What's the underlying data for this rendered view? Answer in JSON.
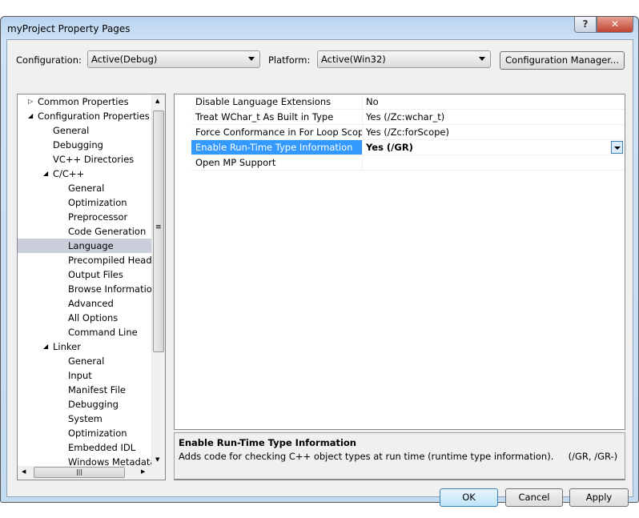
{
  "window": {
    "title": "myProject Property Pages",
    "help": "?",
    "close": "✕"
  },
  "toolbar": {
    "config_label": "Configuration:",
    "config_value": "Active(Debug)",
    "platform_label": "Platform:",
    "platform_value": "Active(Win32)",
    "config_manager": "Configuration Manager..."
  },
  "tree": {
    "items": [
      {
        "label": "Common Properties",
        "level": 0,
        "expander": "collapsed"
      },
      {
        "label": "Configuration Properties",
        "level": 0,
        "expander": "expanded"
      },
      {
        "label": "General",
        "level": 1
      },
      {
        "label": "Debugging",
        "level": 1
      },
      {
        "label": "VC++ Directories",
        "level": 1
      },
      {
        "label": "C/C++",
        "level": 1,
        "expander": "expanded"
      },
      {
        "label": "General",
        "level": 2
      },
      {
        "label": "Optimization",
        "level": 2
      },
      {
        "label": "Preprocessor",
        "level": 2
      },
      {
        "label": "Code Generation",
        "level": 2
      },
      {
        "label": "Language",
        "level": 2,
        "selected": true
      },
      {
        "label": "Precompiled Heade",
        "level": 2
      },
      {
        "label": "Output Files",
        "level": 2
      },
      {
        "label": "Browse Information",
        "level": 2
      },
      {
        "label": "Advanced",
        "level": 2
      },
      {
        "label": "All Options",
        "level": 2
      },
      {
        "label": "Command Line",
        "level": 2
      },
      {
        "label": "Linker",
        "level": 1,
        "expander": "expanded"
      },
      {
        "label": "General",
        "level": 2
      },
      {
        "label": "Input",
        "level": 2
      },
      {
        "label": "Manifest File",
        "level": 2
      },
      {
        "label": "Debugging",
        "level": 2
      },
      {
        "label": "System",
        "level": 2
      },
      {
        "label": "Optimization",
        "level": 2
      },
      {
        "label": "Embedded IDL",
        "level": 2
      },
      {
        "label": "Windows Metadata",
        "level": 2
      }
    ]
  },
  "grid": {
    "rows": [
      {
        "name": "Disable Language Extensions",
        "value": "No"
      },
      {
        "name": "Treat WChar_t As Built in Type",
        "value": "Yes (/Zc:wchar_t)"
      },
      {
        "name": "Force Conformance in For Loop Scope",
        "value": "Yes (/Zc:forScope)"
      },
      {
        "name": "Enable Run-Time Type Information",
        "value": "Yes (/GR)",
        "selected": true
      },
      {
        "name": "Open MP Support",
        "value": ""
      }
    ]
  },
  "description": {
    "title": "Enable Run-Time Type Information",
    "text": "Adds code for checking C++ object types at run time (runtime type information).     (/GR, /GR-)"
  },
  "buttons": {
    "ok": "OK",
    "cancel": "Cancel",
    "apply": "Apply"
  },
  "colors": {
    "selection": "#3399ff",
    "tree_selection": "#cbcfdc"
  }
}
